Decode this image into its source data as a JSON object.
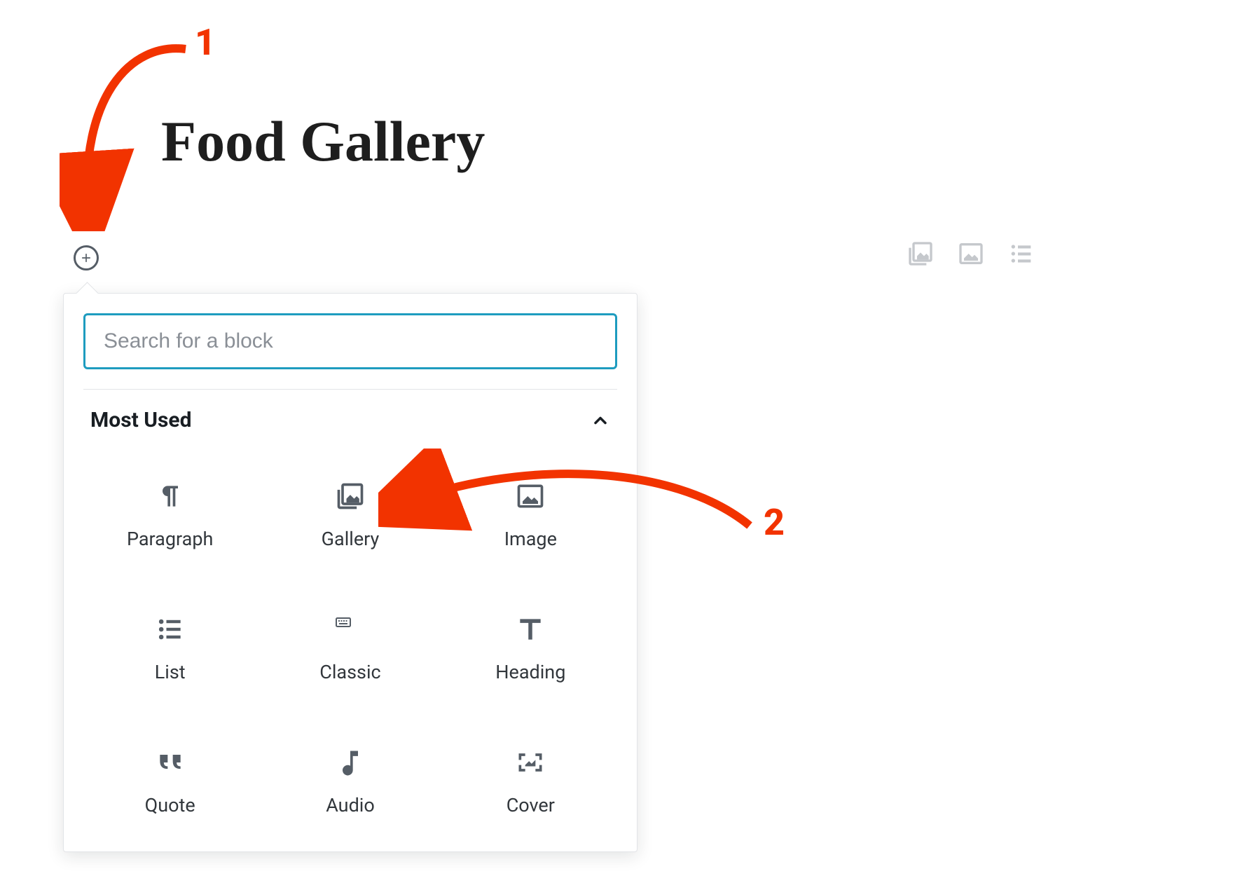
{
  "title": "Food Gallery",
  "annotations": {
    "num1": "1",
    "num2": "2"
  },
  "inserter": {
    "search_placeholder": "Search for a block",
    "category_label": "Most Used",
    "blocks": [
      {
        "id": "paragraph",
        "label": "Paragraph"
      },
      {
        "id": "gallery",
        "label": "Gallery"
      },
      {
        "id": "image",
        "label": "Image"
      },
      {
        "id": "list",
        "label": "List"
      },
      {
        "id": "classic",
        "label": "Classic"
      },
      {
        "id": "heading",
        "label": "Heading"
      },
      {
        "id": "quote",
        "label": "Quote"
      },
      {
        "id": "audio",
        "label": "Audio"
      },
      {
        "id": "cover",
        "label": "Cover"
      }
    ]
  }
}
